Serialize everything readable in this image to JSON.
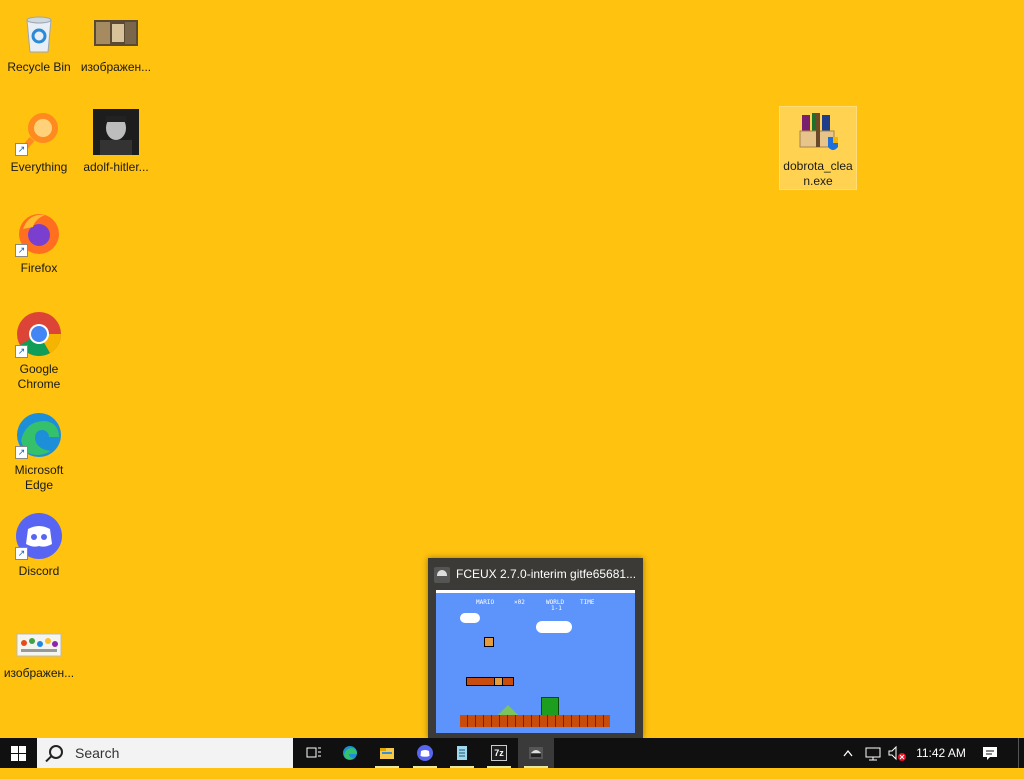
{
  "desktop": {
    "icons": [
      {
        "label": "Recycle Bin"
      },
      {
        "label": "изображен..."
      },
      {
        "label": "Everything"
      },
      {
        "label": "adolf-hitler..."
      },
      {
        "label": "Firefox"
      },
      {
        "label": "Google Chrome"
      },
      {
        "label": "Microsoft Edge"
      },
      {
        "label": "Discord"
      },
      {
        "label": "изображен..."
      },
      {
        "label": "dobrota_clean.exe"
      }
    ]
  },
  "preview": {
    "title": "FCEUX 2.7.0-interim gitfe65681...",
    "hud_left": "MARIO",
    "hud_mid": "×02",
    "hud_world": "WORLD",
    "hud_world_num": "1-1",
    "hud_time": "TIME"
  },
  "taskbar": {
    "search_placeholder": "Search",
    "clock": "11:42 AM",
    "apps": [
      {
        "icon": "task-view-icon"
      },
      {
        "icon": "edge-icon"
      },
      {
        "icon": "file-explorer-icon"
      },
      {
        "icon": "discord-icon"
      },
      {
        "icon": "notepad-icon"
      },
      {
        "icon": "7zip-icon",
        "text": "7z"
      },
      {
        "icon": "fceux-icon"
      }
    ]
  },
  "colors": {
    "wallpaper": "#ffc20e",
    "taskbar": "#101010",
    "nes_sky": "#5c94fc"
  }
}
